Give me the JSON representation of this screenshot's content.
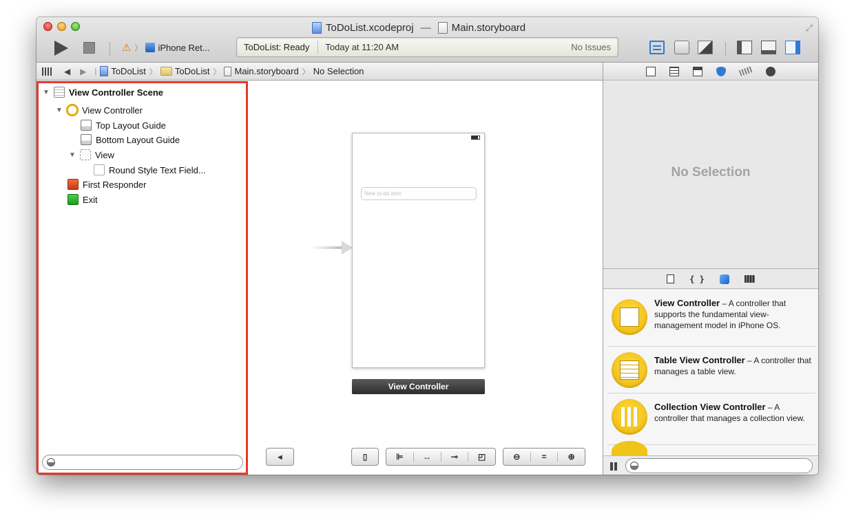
{
  "window": {
    "title_file": "ToDoList.xcodeproj",
    "title_dash": "—",
    "title_doc": "Main.storyboard"
  },
  "toolbar": {
    "scheme_device": "iPhone Ret...",
    "activity_status": "ToDoList: Ready",
    "activity_time": "Today at 11:20 AM",
    "activity_issues": "No Issues"
  },
  "jumpbar": {
    "items": [
      "ToDoList",
      "ToDoList",
      "Main.storyboard",
      "No Selection"
    ]
  },
  "navigator": {
    "rows": [
      "View Controller Scene",
      "View Controller",
      "Top Layout Guide",
      "Bottom Layout Guide",
      "View",
      "Round Style Text Field...",
      "First Responder",
      "Exit"
    ]
  },
  "canvas": {
    "textfield_placeholder": "New to-do item",
    "scene_label": "View Controller"
  },
  "inspector": {
    "empty_message": "No Selection"
  },
  "library": {
    "code_icon_label": "{ }",
    "items": [
      {
        "title": "View Controller",
        "desc": " – A controller that supports the fundamental view-management model in iPhone OS."
      },
      {
        "title": "Table View Controller",
        "desc": " – A controller that manages a table view."
      },
      {
        "title": "Collection View Controller",
        "desc": " – A controller that manages a collection view."
      }
    ]
  },
  "colors": {
    "selection_outline": "#e5392b",
    "accent_blue": "#2e7bd4",
    "object_yellow": "#f0c418"
  }
}
